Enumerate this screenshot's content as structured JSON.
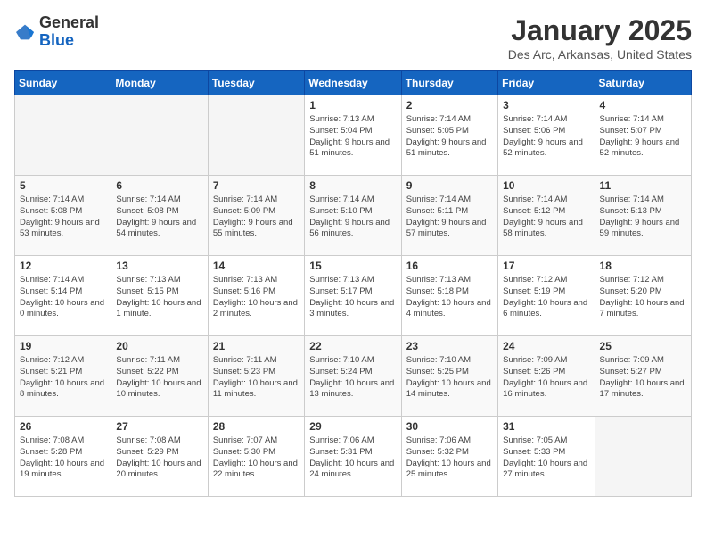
{
  "header": {
    "logo_general": "General",
    "logo_blue": "Blue",
    "month_title": "January 2025",
    "location": "Des Arc, Arkansas, United States"
  },
  "weekdays": [
    "Sunday",
    "Monday",
    "Tuesday",
    "Wednesday",
    "Thursday",
    "Friday",
    "Saturday"
  ],
  "weeks": [
    [
      {
        "day": null,
        "sunrise": null,
        "sunset": null,
        "daylight": null
      },
      {
        "day": null,
        "sunrise": null,
        "sunset": null,
        "daylight": null
      },
      {
        "day": null,
        "sunrise": null,
        "sunset": null,
        "daylight": null
      },
      {
        "day": 1,
        "sunrise": "7:13 AM",
        "sunset": "5:04 PM",
        "daylight": "9 hours and 51 minutes."
      },
      {
        "day": 2,
        "sunrise": "7:14 AM",
        "sunset": "5:05 PM",
        "daylight": "9 hours and 51 minutes."
      },
      {
        "day": 3,
        "sunrise": "7:14 AM",
        "sunset": "5:06 PM",
        "daylight": "9 hours and 52 minutes."
      },
      {
        "day": 4,
        "sunrise": "7:14 AM",
        "sunset": "5:07 PM",
        "daylight": "9 hours and 52 minutes."
      }
    ],
    [
      {
        "day": 5,
        "sunrise": "7:14 AM",
        "sunset": "5:08 PM",
        "daylight": "9 hours and 53 minutes."
      },
      {
        "day": 6,
        "sunrise": "7:14 AM",
        "sunset": "5:08 PM",
        "daylight": "9 hours and 54 minutes."
      },
      {
        "day": 7,
        "sunrise": "7:14 AM",
        "sunset": "5:09 PM",
        "daylight": "9 hours and 55 minutes."
      },
      {
        "day": 8,
        "sunrise": "7:14 AM",
        "sunset": "5:10 PM",
        "daylight": "9 hours and 56 minutes."
      },
      {
        "day": 9,
        "sunrise": "7:14 AM",
        "sunset": "5:11 PM",
        "daylight": "9 hours and 57 minutes."
      },
      {
        "day": 10,
        "sunrise": "7:14 AM",
        "sunset": "5:12 PM",
        "daylight": "9 hours and 58 minutes."
      },
      {
        "day": 11,
        "sunrise": "7:14 AM",
        "sunset": "5:13 PM",
        "daylight": "9 hours and 59 minutes."
      }
    ],
    [
      {
        "day": 12,
        "sunrise": "7:14 AM",
        "sunset": "5:14 PM",
        "daylight": "10 hours and 0 minutes."
      },
      {
        "day": 13,
        "sunrise": "7:13 AM",
        "sunset": "5:15 PM",
        "daylight": "10 hours and 1 minute."
      },
      {
        "day": 14,
        "sunrise": "7:13 AM",
        "sunset": "5:16 PM",
        "daylight": "10 hours and 2 minutes."
      },
      {
        "day": 15,
        "sunrise": "7:13 AM",
        "sunset": "5:17 PM",
        "daylight": "10 hours and 3 minutes."
      },
      {
        "day": 16,
        "sunrise": "7:13 AM",
        "sunset": "5:18 PM",
        "daylight": "10 hours and 4 minutes."
      },
      {
        "day": 17,
        "sunrise": "7:12 AM",
        "sunset": "5:19 PM",
        "daylight": "10 hours and 6 minutes."
      },
      {
        "day": 18,
        "sunrise": "7:12 AM",
        "sunset": "5:20 PM",
        "daylight": "10 hours and 7 minutes."
      }
    ],
    [
      {
        "day": 19,
        "sunrise": "7:12 AM",
        "sunset": "5:21 PM",
        "daylight": "10 hours and 8 minutes."
      },
      {
        "day": 20,
        "sunrise": "7:11 AM",
        "sunset": "5:22 PM",
        "daylight": "10 hours and 10 minutes."
      },
      {
        "day": 21,
        "sunrise": "7:11 AM",
        "sunset": "5:23 PM",
        "daylight": "10 hours and 11 minutes."
      },
      {
        "day": 22,
        "sunrise": "7:10 AM",
        "sunset": "5:24 PM",
        "daylight": "10 hours and 13 minutes."
      },
      {
        "day": 23,
        "sunrise": "7:10 AM",
        "sunset": "5:25 PM",
        "daylight": "10 hours and 14 minutes."
      },
      {
        "day": 24,
        "sunrise": "7:09 AM",
        "sunset": "5:26 PM",
        "daylight": "10 hours and 16 minutes."
      },
      {
        "day": 25,
        "sunrise": "7:09 AM",
        "sunset": "5:27 PM",
        "daylight": "10 hours and 17 minutes."
      }
    ],
    [
      {
        "day": 26,
        "sunrise": "7:08 AM",
        "sunset": "5:28 PM",
        "daylight": "10 hours and 19 minutes."
      },
      {
        "day": 27,
        "sunrise": "7:08 AM",
        "sunset": "5:29 PM",
        "daylight": "10 hours and 20 minutes."
      },
      {
        "day": 28,
        "sunrise": "7:07 AM",
        "sunset": "5:30 PM",
        "daylight": "10 hours and 22 minutes."
      },
      {
        "day": 29,
        "sunrise": "7:06 AM",
        "sunset": "5:31 PM",
        "daylight": "10 hours and 24 minutes."
      },
      {
        "day": 30,
        "sunrise": "7:06 AM",
        "sunset": "5:32 PM",
        "daylight": "10 hours and 25 minutes."
      },
      {
        "day": 31,
        "sunrise": "7:05 AM",
        "sunset": "5:33 PM",
        "daylight": "10 hours and 27 minutes."
      },
      {
        "day": null,
        "sunrise": null,
        "sunset": null,
        "daylight": null
      }
    ]
  ]
}
